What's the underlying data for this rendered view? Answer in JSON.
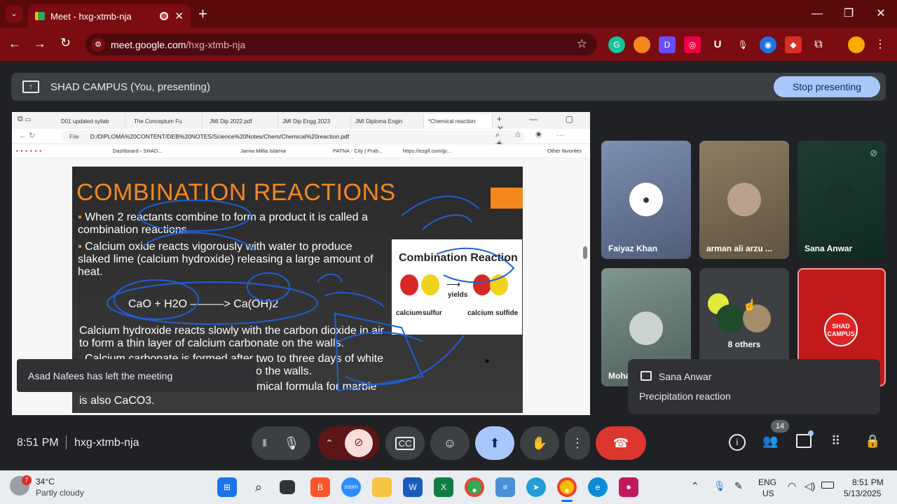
{
  "browser": {
    "tab_title": "Meet - hxg-xtmb-nja",
    "new_tab": "+",
    "url_domain": "meet.google.com",
    "url_path": "/hxg-xtmb-nja"
  },
  "presenting": {
    "label": "SHAD CAMPUS (You, presenting)",
    "stop_label": "Stop presenting"
  },
  "shared": {
    "tabs": [
      "D01 updated syllab",
      "The Conceptum Fu",
      "JMI Dip 2022.pdf",
      "JMI Dip Engg 2023",
      "JMI Diploma Engin",
      "*Chemical reaction"
    ],
    "file_label": "File",
    "url": "D:/DIPLOMA%20CONTENT/DEB%20NOTES/Science%20Notes/Chem/Chemical%20reaction.pdf",
    "bookmarks": [
      "Dashboard ‹ SHAD...",
      "Jamia Millia Islamia",
      "PATNA - City | Prab...",
      "https://ezgif.com/jp...",
      "Other favorites"
    ],
    "slide": {
      "title": "COMBINATION REACTIONS",
      "bullet1": "When 2 reactants combine to form a product it is called a combination reactions.",
      "bullet2": "Calcium oxide reacts vigorously with water to produce slaked lime (calcium hydroxide) releasing a large amount of heat.",
      "equation": "CaO + H2O ———> Ca(OH)2",
      "para1": "Calcium hydroxide reacts slowly with the carbon dioxide in air to form a thin layer of calcium carbonate on the walls.",
      "para2": "Calcium carbonate is formed after two to three days of white",
      "para3": "o the walls.",
      "para4": "emical formula for marble",
      "para5": "is also CaCO3.",
      "box_title": "Combination Reaction",
      "box_yields": "yields",
      "box_calcium": "calcium",
      "box_sulfur": "sulfur",
      "box_product": "calcium sulfide"
    }
  },
  "participants": [
    {
      "name": "Faiyaz Khan"
    },
    {
      "name": "arman ali arzu ..."
    },
    {
      "name": "Sana Anwar"
    },
    {
      "name": "Moha"
    },
    {
      "name": "8 others"
    },
    {
      "name": "SHAD CAMPUS"
    }
  ],
  "toast": "Asad Nafees has left the meeting",
  "chat": {
    "sender": "Sana Anwar",
    "message": "Precipitation reaction"
  },
  "meeting": {
    "time": "8:51 PM",
    "code": "hxg-xtmb-nja",
    "people_count": "14"
  },
  "taskbar": {
    "weather_temp": "34°C",
    "weather_desc": "Partly cloudy",
    "weather_badge": "7",
    "lang1": "ENG",
    "lang2": "US",
    "clock_time": "8:51 PM",
    "clock_date": "5/13/2025"
  }
}
